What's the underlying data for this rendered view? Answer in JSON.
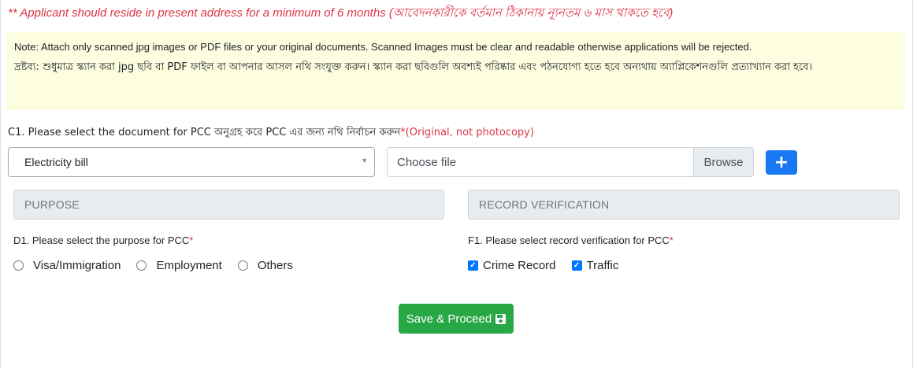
{
  "residence_note": "** Applicant should reside in present address for a minimum of 6 months (আবেদনকারীকে বর্তমান ঠিকানায় ন্যূনতম ৬ মাস থাকতে হবে)",
  "note": {
    "english": "Note: Attach only scanned jpg images or PDF files or your original documents. Scanned Images must be clear and readable otherwise applications will be rejected.",
    "bengali": "দ্রষ্টব্য: শুধুমাত্র স্ক্যান করা jpg ছবি বা PDF ফাইল বা আপনার আসল নথি সংযুক্ত করুন। স্ক্যান করা ছবিগুলি অবশ্যই পরিষ্কার এবং পঠনযোগ্য হতে হবে অন্যথায় অ্যাপ্লিকেশনগুলি প্রত্যাখ্যান করা হবে।"
  },
  "document_section": {
    "label": "C1. Please select the document for PCC অনুগ্রহ করে PCC এর জন্য নথি নির্বাচন করুন",
    "required_note": "*(Original, not photocopy)",
    "selected_document": "Electricity bill",
    "file_placeholder": "Choose file",
    "browse_label": "Browse",
    "add_label": "+"
  },
  "purpose_section": {
    "header": "PURPOSE",
    "label": "D1. Please select the purpose for PCC",
    "required_mark": "*",
    "options": [
      "Visa/Immigration",
      "Employment",
      "Others"
    ]
  },
  "record_section": {
    "header": "RECORD VERIFICATION",
    "label": "F1. Please select record verification for PCC",
    "required_mark": "*",
    "options": [
      {
        "label": "Crime Record",
        "checked": true
      },
      {
        "label": "Traffic",
        "checked": true
      }
    ]
  },
  "save_button": {
    "label": "Save & Proceed",
    "icon": "floppy-disk-icon"
  },
  "colors": {
    "required_red": "#dc3545",
    "note_background": "#fdfde0",
    "primary_blue": "#1878f3",
    "success_green": "#28a745"
  }
}
